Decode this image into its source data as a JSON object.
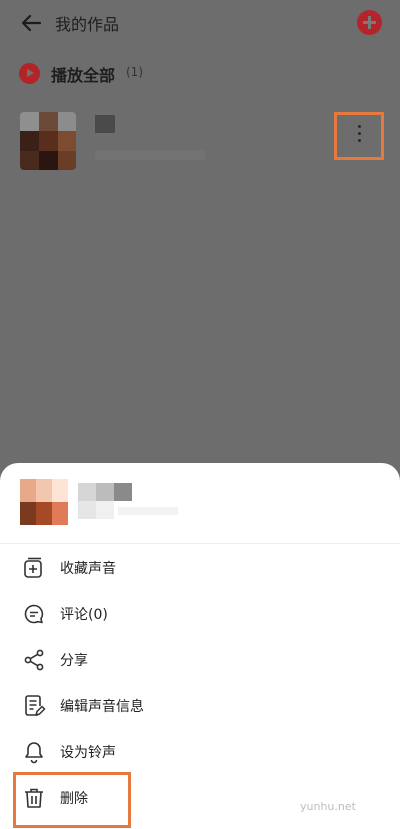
{
  "header": {
    "title": "我的作品"
  },
  "play_all": {
    "label": "播放全部",
    "count": "(1)"
  },
  "sheet": {
    "menu": [
      {
        "label": "收藏声音",
        "icon": "add-to-collection-icon"
      },
      {
        "label": "评论(0)",
        "icon": "comment-icon"
      },
      {
        "label": "分享",
        "icon": "share-icon"
      },
      {
        "label": "编辑声音信息",
        "icon": "edit-info-icon"
      },
      {
        "label": "设为铃声",
        "icon": "bell-icon"
      },
      {
        "label": "删除",
        "icon": "trash-icon"
      }
    ]
  },
  "watermark": "yunhu.net",
  "colors": {
    "accent": "#b3252a",
    "highlight": "#e6793e",
    "overlay": "#6d6d6d"
  }
}
